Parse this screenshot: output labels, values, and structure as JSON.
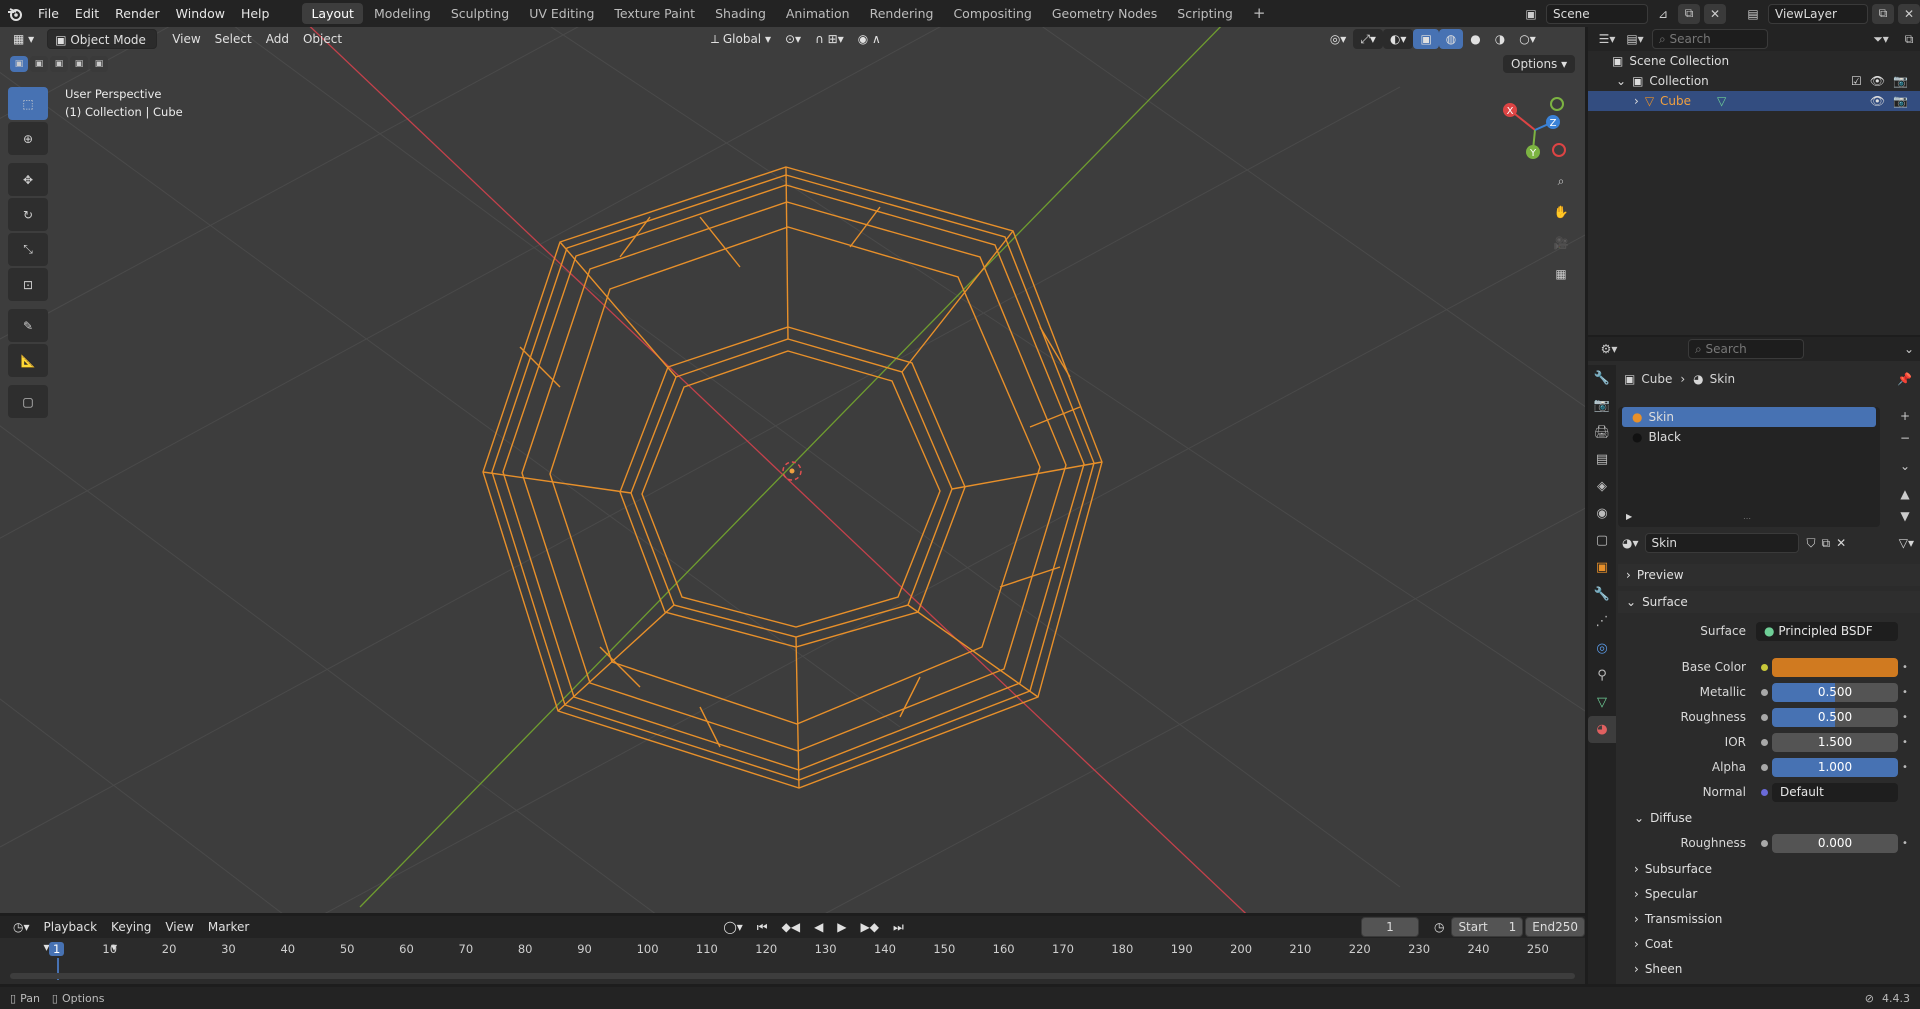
{
  "topbar": {
    "menus": [
      "File",
      "Edit",
      "Render",
      "Window",
      "Help"
    ],
    "workspaces": [
      "Layout",
      "Modeling",
      "Sculpting",
      "UV Editing",
      "Texture Paint",
      "Shading",
      "Animation",
      "Rendering",
      "Compositing",
      "Geometry Nodes",
      "Scripting"
    ],
    "active_workspace": "Layout",
    "scene": "Scene",
    "view_layer": "ViewLayer"
  },
  "viewport": {
    "mode": "Object Mode",
    "menus": [
      "View",
      "Select",
      "Add",
      "Object"
    ],
    "orientation": "Global",
    "options_label": "Options",
    "perspective": "User Perspective",
    "collection_info": "(1) Collection | Cube",
    "gizmo_axes": [
      "X",
      "Y",
      "Z"
    ]
  },
  "outliner": {
    "search_placeholder": "Search",
    "rows": [
      "Scene Collection",
      "Collection",
      "Cube"
    ]
  },
  "properties": {
    "search_placeholder": "Search",
    "breadcrumb_object": "Cube",
    "breadcrumb_material": "Skin",
    "slots": [
      "Skin",
      "Black"
    ],
    "material_name": "Skin",
    "sections": {
      "preview": "Preview",
      "surface": "Surface",
      "diffuse": "Diffuse",
      "collapsed": [
        "Subsurface",
        "Specular",
        "Transmission",
        "Coat",
        "Sheen"
      ]
    },
    "fields": {
      "surface_label": "Surface",
      "surface_value": "Principled BSDF",
      "base_color_label": "Base Color",
      "base_color": "#d07a20",
      "metallic_label": "Metallic",
      "metallic": "0.500",
      "roughness_label": "Roughness",
      "roughness": "0.500",
      "ior_label": "IOR",
      "ior": "1.500",
      "alpha_label": "Alpha",
      "alpha": "1.000",
      "normal_label": "Normal",
      "normal": "Default",
      "diffuse_roughness_label": "Roughness",
      "diffuse_roughness": "0.000"
    }
  },
  "timeline": {
    "menus": [
      "Playback",
      "Keying",
      "View",
      "Marker"
    ],
    "current_frame": "1",
    "start_label": "Start",
    "start": "1",
    "end_label": "End",
    "end": "250",
    "ruler": [
      "1",
      "10",
      "20",
      "30",
      "40",
      "50",
      "60",
      "70",
      "80",
      "90",
      "100",
      "110",
      "120",
      "130",
      "140",
      "150",
      "160",
      "170",
      "180",
      "190",
      "200",
      "210",
      "220",
      "230",
      "240",
      "250"
    ]
  },
  "statusbar": {
    "pan": "Pan",
    "options": "Options",
    "version": "4.4.3"
  },
  "colors": {
    "accent": "#4772b3",
    "wire": "#e8902a",
    "x_axis": "#c4414b",
    "y_axis": "#6f9d2f"
  }
}
